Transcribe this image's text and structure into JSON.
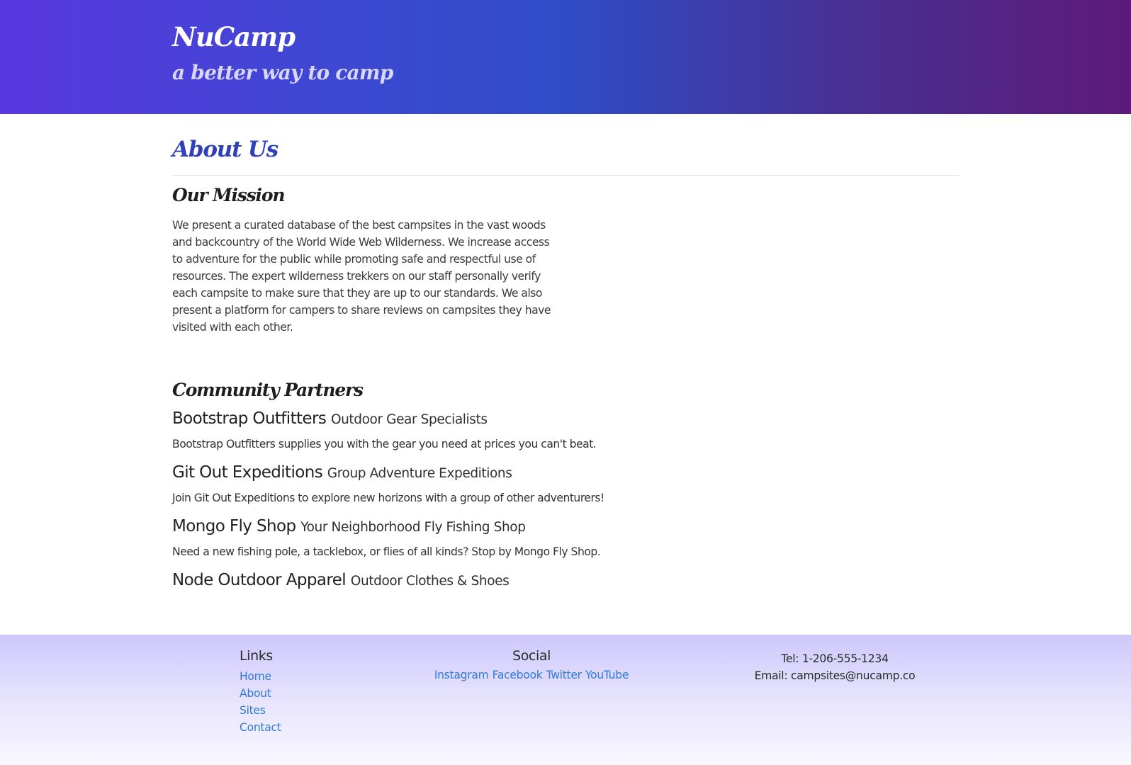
{
  "header": {
    "brand": "NuCamp",
    "tagline": "a better way to camp"
  },
  "main": {
    "page_title": "About Us",
    "mission": {
      "heading": "Our Mission",
      "text": "We present a curated database of the best campsites in the vast woods and backcountry of the World Wide Web Wilderness. We increase access to adventure for the public while promoting safe and respectful use of resources. The expert wilderness trekkers on our staff personally verify each campsite to make sure that they are up to our standards. We also present a platform for campers to share reviews on campsites they have visited with each other."
    },
    "partners": {
      "heading": "Community Partners",
      "items": [
        {
          "name": "Bootstrap Outfitters",
          "tagline": "Outdoor Gear Specialists",
          "description": "Bootstrap Outfitters supplies you with the gear you need at prices you can't beat."
        },
        {
          "name": "Git Out Expeditions",
          "tagline": "Group Adventure Expeditions",
          "description": "Join Git Out Expeditions to explore new horizons with a group of other adventurers!"
        },
        {
          "name": "Mongo Fly Shop",
          "tagline": "Your Neighborhood Fly Fishing Shop",
          "description": "Need a new fishing pole, a tacklebox, or flies of all kinds? Stop by Mongo Fly Shop."
        },
        {
          "name": "Node Outdoor Apparel",
          "tagline": "Outdoor Clothes & Shoes",
          "description": ""
        }
      ]
    }
  },
  "footer": {
    "links": {
      "heading": "Links",
      "items": [
        "Home",
        "About",
        "Sites",
        "Contact"
      ]
    },
    "social": {
      "heading": "Social",
      "items": [
        "Instagram",
        "Facebook",
        "Twitter",
        "YouTube"
      ]
    },
    "contact": {
      "tel": "Tel: 1-206-555-1234",
      "email": "Email: campsites@nucamp.co"
    }
  },
  "colors": {
    "header_gradient_start": "#5a38e0",
    "header_gradient_mid": "#2f4cc6",
    "header_gradient_end": "#5d1a7a",
    "title_accent": "#3040b9",
    "link": "#2f7ad8",
    "footer_gradient_top": "#cec8fb"
  }
}
